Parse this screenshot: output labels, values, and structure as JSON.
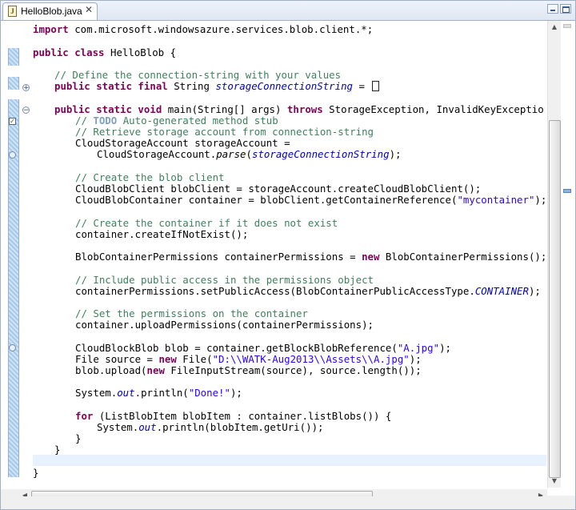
{
  "editor_tab": {
    "title": "HelloBlob.java",
    "close_glyph": "✕",
    "icon": "java-file-icon"
  },
  "window_controls": {
    "minimize": "minimize-icon",
    "maximize": "maximize-icon"
  },
  "code": {
    "line_import": [
      "import",
      " com.microsoft.windowsazure.services.blob.client.*;"
    ],
    "line_class": [
      "public class",
      " HelloBlob {"
    ],
    "line_c1": "// Define the connection-string with your values",
    "line_field": [
      "public static final",
      " String ",
      "storageConnectionString",
      " = "
    ],
    "line_main": [
      "public static void",
      " main(String[] args) ",
      "throws",
      " StorageException, InvalidKeyException, URISynta"
    ],
    "line_todo": [
      "// ",
      "TODO",
      " Auto-generated method stub"
    ],
    "line_c2": "// Retrieve storage account from connection-string",
    "line_acct1": "CloudStorageAccount storageAccount =",
    "line_acct2": [
      "CloudStorageAccount.",
      "parse",
      "(",
      "storageConnectionString",
      ");"
    ],
    "line_c3": "// Create the blob client",
    "line_client": "CloudBlobClient blobClient = storageAccount.createCloudBlobClient();",
    "line_container": [
      "CloudBlobContainer container = blobClient.getContainerReference(",
      "\"mycontainer\"",
      ");"
    ],
    "line_c4": "// Create the container if it does not exist",
    "line_create": "container.createIfNotExist();",
    "line_perm": [
      "BlobContainerPermissions containerPermissions = ",
      "new",
      " BlobContainerPermissions();"
    ],
    "line_c5": "// Include public access in the permissions object",
    "line_setacc": [
      "containerPermissions.setPublicAccess(BlobContainerPublicAccessType.",
      "CONTAINER",
      ");"
    ],
    "line_c6": "// Set the permissions on the container",
    "line_upload_perm": "container.uploadPermissions(containerPermissions);",
    "line_blob": [
      "CloudBlockBlob blob = container.getBlockBlobReference(",
      "\"A.jpg\"",
      ");"
    ],
    "line_file": [
      "File source = ",
      "new",
      " File(",
      "\"D:\\\\WATK-Aug2013\\\\Assets\\\\A.jpg\"",
      ");"
    ],
    "line_upload": [
      "blob.upload(",
      "new",
      " FileInputStream(source), source.length());"
    ],
    "line_done": [
      "System.",
      "out",
      ".println(",
      "\"Done!\"",
      ");"
    ],
    "line_for": [
      "for",
      " (ListBlobItem blobItem : container.listBlobs()) {"
    ],
    "line_print": [
      "System.",
      "out",
      ".println(blobItem.getUri());"
    ],
    "line_close_for": "}",
    "line_close_main": "}",
    "line_close_class": "}"
  },
  "colors": {
    "keyword": "#7f0055",
    "comment": "#3f7f5f",
    "string": "#2a00ff",
    "field": "#0000c0",
    "current_line": "#e8f2fe"
  }
}
